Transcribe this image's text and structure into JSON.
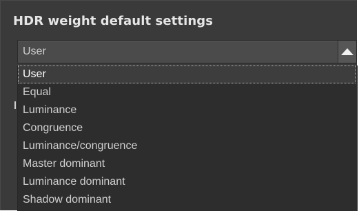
{
  "section": {
    "title": "HDR weight default settings"
  },
  "combo": {
    "value": "User",
    "arrow_icon": "triangle-up-icon"
  },
  "dropdown": {
    "selected_index": 0,
    "options": [
      "User",
      "Equal",
      "Luminance",
      "Congruence",
      "Luminance/congruence",
      "Master dominant",
      "Luminance dominant",
      "Shadow dominant"
    ]
  },
  "colors": {
    "panel_bg": "#3a3a3a",
    "dropdown_bg": "#2d2d2d",
    "text": "#d0d0d0",
    "title_text": "#e6e6e6"
  }
}
